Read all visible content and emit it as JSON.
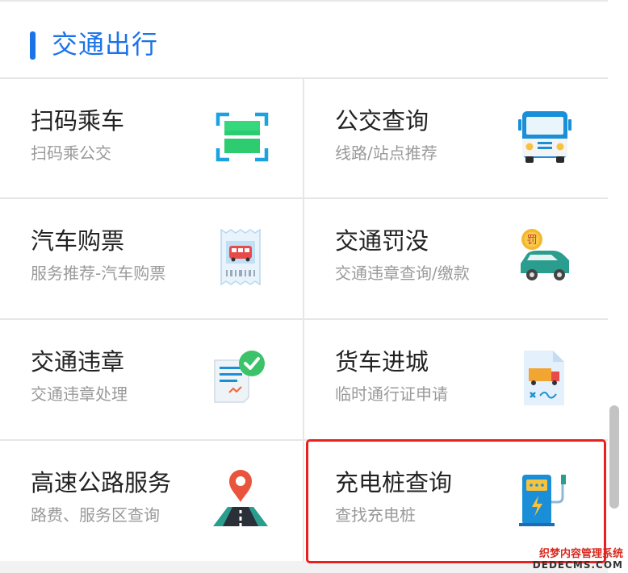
{
  "section": {
    "title": "交通出行"
  },
  "services": [
    {
      "title": "扫码乘车",
      "subtitle": "扫码乘公交",
      "icon": "qr-scan-icon"
    },
    {
      "title": "公交查询",
      "subtitle": "线路/站点推荐",
      "icon": "bus-icon"
    },
    {
      "title": "汽车购票",
      "subtitle": "服务推荐-汽车购票",
      "icon": "bus-ticket-icon"
    },
    {
      "title": "交通罚没",
      "subtitle": "交通违章查询/缴款",
      "icon": "traffic-fine-icon"
    },
    {
      "title": "交通违章",
      "subtitle": "交通违章处理",
      "icon": "violation-check-icon"
    },
    {
      "title": "货车进城",
      "subtitle": "临时通行证申请",
      "icon": "truck-permit-icon"
    },
    {
      "title": "高速公路服务",
      "subtitle": "路费、服务区查询",
      "icon": "highway-pin-icon"
    },
    {
      "title": "充电桩查询",
      "subtitle": "查找充电桩",
      "icon": "charging-pile-icon"
    }
  ],
  "icon_texts": {
    "fine_badge": "罚"
  },
  "highlight": {
    "target": "充电桩查询",
    "color": "#e8201e"
  },
  "colors": {
    "accent": "#1a73e8",
    "title_text": "#222222",
    "subtitle_text": "#9a9a9a"
  },
  "watermark": {
    "line1": "织梦内容管理系统",
    "line2": "DEDECMS.COM"
  }
}
